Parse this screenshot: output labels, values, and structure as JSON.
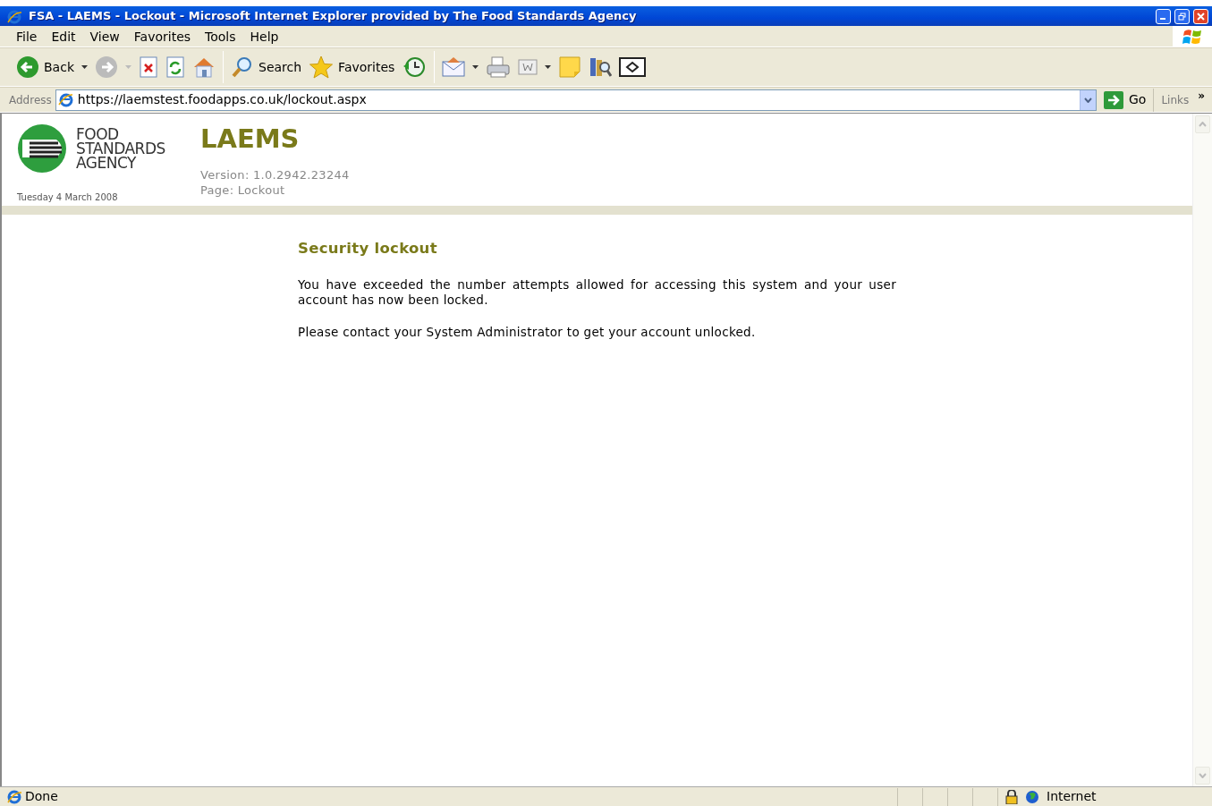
{
  "window": {
    "title": "FSA - LAEMS - Lockout - Microsoft Internet Explorer provided by The Food Standards Agency"
  },
  "menu": [
    {
      "label": "File"
    },
    {
      "label": "Edit"
    },
    {
      "label": "View"
    },
    {
      "label": "Favorites"
    },
    {
      "label": "Tools"
    },
    {
      "label": "Help"
    }
  ],
  "toolbar": [
    {
      "kind": "back",
      "label": "Back",
      "dropdown": true,
      "disabled": false
    },
    {
      "kind": "forward",
      "dropdown": true,
      "disabled": true
    },
    {
      "kind": "stop"
    },
    {
      "kind": "refresh"
    },
    {
      "kind": "home"
    },
    {
      "kind": "separator"
    },
    {
      "kind": "search",
      "label": "Search"
    },
    {
      "kind": "favorites",
      "label": "Favorites"
    },
    {
      "kind": "history"
    },
    {
      "kind": "separator"
    },
    {
      "kind": "mail",
      "dropdown": true
    },
    {
      "kind": "print"
    },
    {
      "kind": "edit",
      "dropdown": true
    },
    {
      "kind": "note"
    },
    {
      "kind": "research"
    },
    {
      "kind": "messenger"
    }
  ],
  "address_bar": {
    "label": "Address",
    "url": "https://laemstest.foodapps.co.uk/lockout.aspx",
    "go": "Go",
    "links": "Links",
    "more": "»"
  },
  "page_header": {
    "logo_lines": [
      "FOOD",
      "STANDARDS",
      "AGENCY"
    ],
    "date": "Tuesday 4 March 2008",
    "app_title": "LAEMS",
    "version": "Version: 1.0.2942.23244",
    "page": "Page: Lockout"
  },
  "content": {
    "heading": "Security lockout",
    "paragraphs": [
      "You have exceeded the number attempts allowed for accessing this system and your user account has now been locked.",
      "Please contact your System Administrator to get your account unlocked."
    ]
  },
  "status_bar": {
    "text": "Done",
    "zone": "Internet"
  }
}
